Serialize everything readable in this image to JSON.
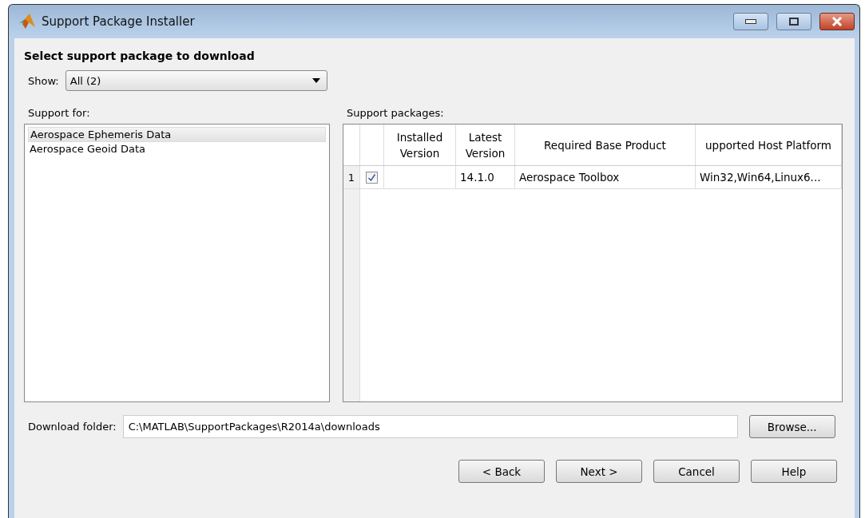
{
  "window": {
    "title": "Support Package Installer"
  },
  "heading": "Select support package to download",
  "show": {
    "label": "Show:",
    "value": "All (2)"
  },
  "support_for": {
    "label": "Support for:",
    "items": [
      {
        "label": "Aerospace Ephemeris Data",
        "selected": true
      },
      {
        "label": "Aerospace Geoid Data",
        "selected": false
      }
    ]
  },
  "packages": {
    "label": "Support packages:",
    "columns": [
      "Installed\nVersion",
      "Latest\nVersion",
      "Required Base Product",
      "upported Host Platform"
    ],
    "rows": [
      {
        "index": "1",
        "checked": true,
        "cells": [
          "",
          "14.1.0",
          "Aerospace Toolbox",
          "Win32,Win64,Linux6..."
        ]
      }
    ]
  },
  "download_folder": {
    "label": "Download folder:",
    "value": "C:\\MATLAB\\SupportPackages\\R2014a\\downloads",
    "browse": "Browse..."
  },
  "buttons": [
    "< Back",
    "Next >",
    "Cancel",
    "Help"
  ]
}
